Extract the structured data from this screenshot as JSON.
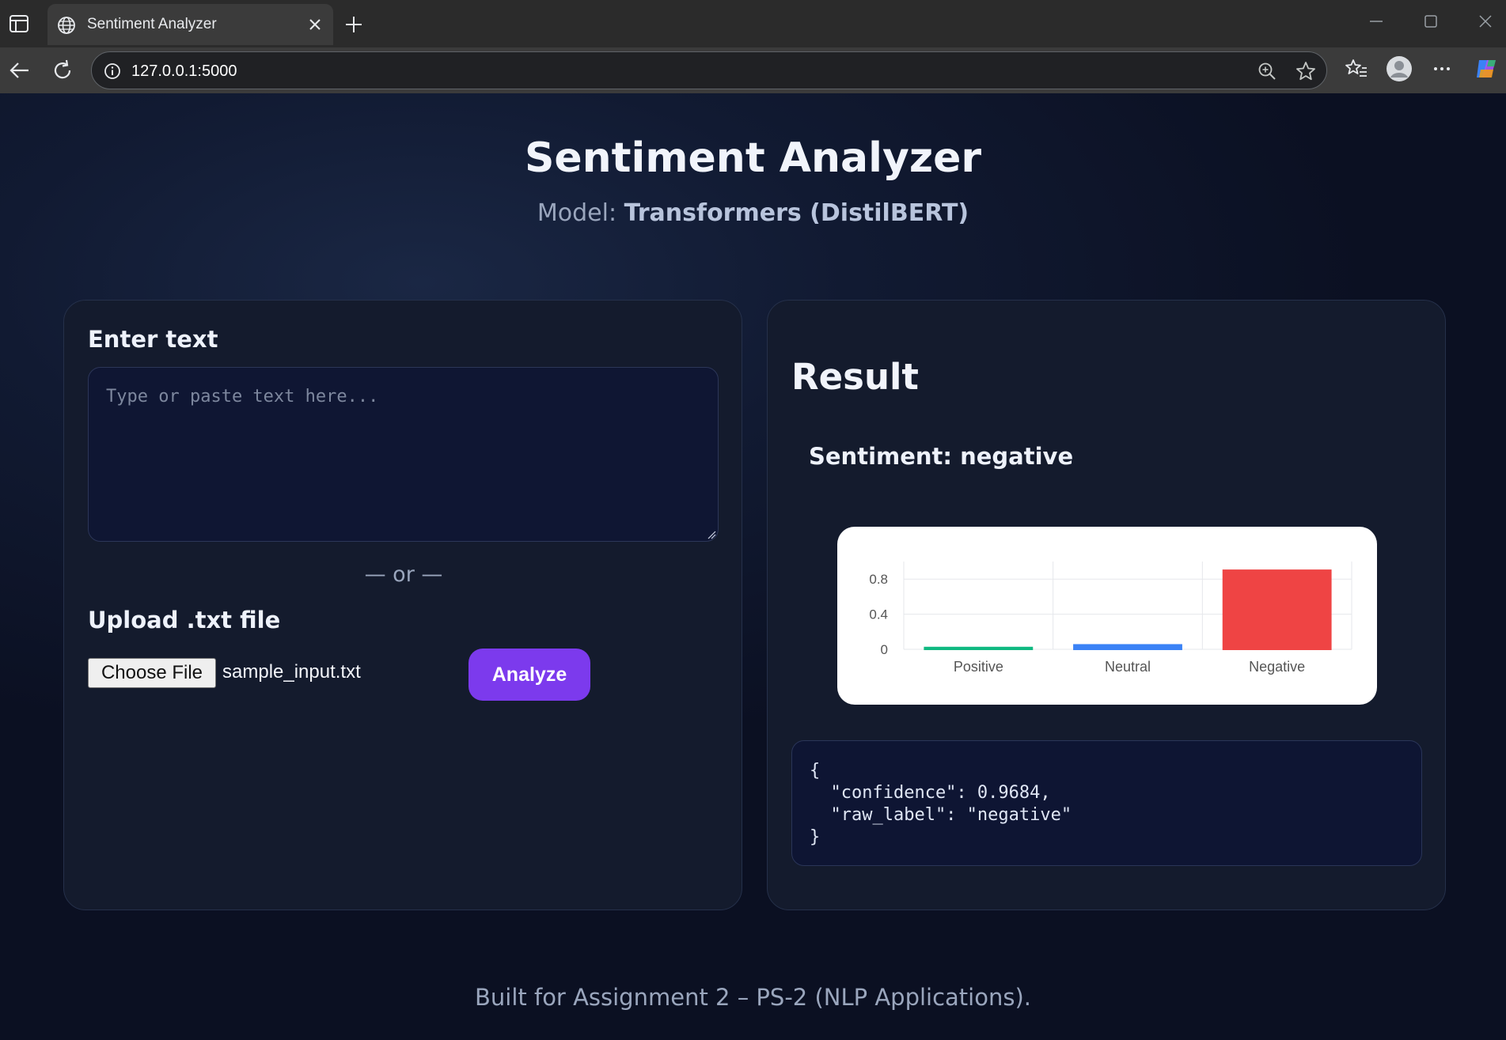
{
  "browser": {
    "tab_title": "Sentiment Analyzer",
    "url": "127.0.0.1:5000"
  },
  "header": {
    "title": "Sentiment Analyzer",
    "model_prefix": "Model: ",
    "model_name": "Transformers (DistilBERT)"
  },
  "input_card": {
    "enter_label": "Enter text",
    "textarea_placeholder": "Type or paste text here...",
    "or_divider": "— or —",
    "upload_label": "Upload .txt file",
    "choose_file_label": "Choose File",
    "file_name": "sample_input.txt",
    "analyze_label": "Analyze"
  },
  "result_card": {
    "title": "Result",
    "sentiment_text": "Sentiment: negative",
    "json_lines": [
      "{",
      "  \"confidence\": 0.9684,",
      "  \"raw_label\": \"negative\"",
      "}"
    ]
  },
  "chart_data": {
    "type": "bar",
    "categories": [
      "Positive",
      "Neutral",
      "Negative"
    ],
    "values": [
      0.02,
      0.05,
      0.9
    ],
    "colors": [
      "#10b981",
      "#3b82f6",
      "#ef4444"
    ],
    "yticks": [
      "0",
      "0.4",
      "0.8"
    ],
    "ylim": [
      0,
      1
    ]
  },
  "footer": "Built for Assignment 2 – PS-2 (NLP Applications).",
  "colors": {
    "accent": "#7c3aed",
    "page_bg": "#0b1020"
  }
}
